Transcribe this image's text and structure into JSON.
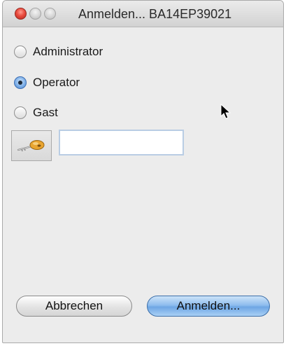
{
  "window": {
    "title": "Anmelden... BA14EP39021"
  },
  "titlebar_buttons": {
    "close_icon": "close-icon",
    "minimize_icon": "minimize-icon",
    "zoom_icon": "zoom-icon"
  },
  "roles": {
    "options": [
      {
        "label": "Administrator",
        "checked": false
      },
      {
        "label": "Operator",
        "checked": true
      },
      {
        "label": "Gast",
        "checked": false
      }
    ],
    "selected": "Operator"
  },
  "login": {
    "key_icon": "key-icon",
    "password_value": ""
  },
  "buttons": {
    "cancel_label": "Abbrechen",
    "login_label": "Anmelden..."
  },
  "colors": {
    "close_red": "#e94c3f",
    "selected_blue": "#6ea6e4",
    "window_bg": "#ececec"
  }
}
